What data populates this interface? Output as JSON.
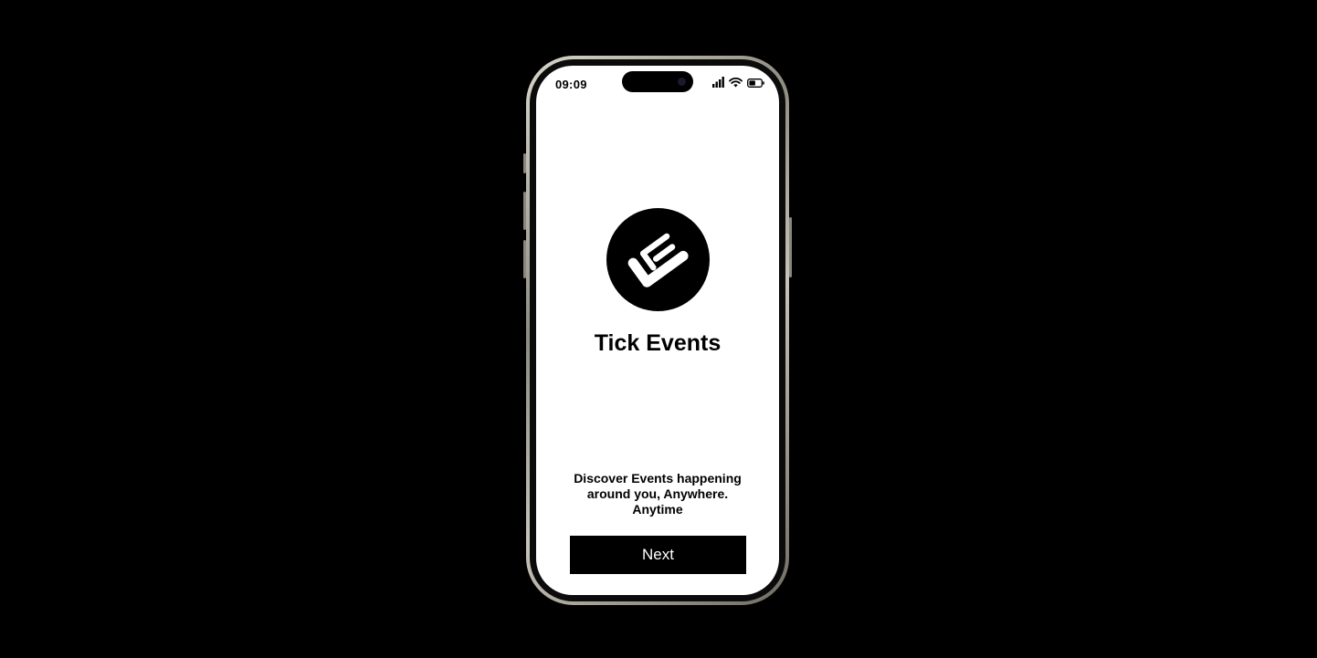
{
  "status_bar": {
    "time": "09:09",
    "icons": [
      "cellular-signal-icon",
      "wifi-icon",
      "battery-icon"
    ]
  },
  "app": {
    "logo_icon": "tick-events-logo-icon",
    "title": "Tick Events",
    "tagline": "Discover Events happening around you, Anywhere. Anytime"
  },
  "actions": {
    "next_label": "Next"
  },
  "colors": {
    "background": "#000000",
    "screen": "#ffffff",
    "accent": "#000000",
    "button_text": "#ffffff"
  }
}
